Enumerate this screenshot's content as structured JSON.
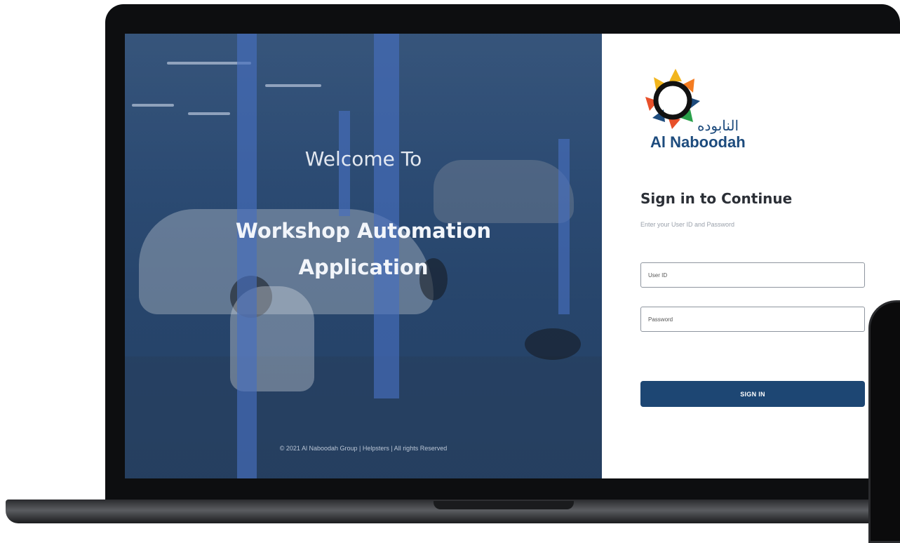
{
  "hero": {
    "welcome_line1": "Welcome To",
    "welcome_line2": "Workshop Automation",
    "welcome_line3": "Application",
    "copyright": "© 2021 Al Naboodah Group | Helpsters | All rights Reserved",
    "overlay_color": "#1e3e68"
  },
  "brand": {
    "name": "Al Naboodah",
    "arabic_name": "النابوده",
    "colors": [
      "#f2b51d",
      "#e8502a",
      "#2aa04a",
      "#1d4b7d",
      "#f47b20"
    ]
  },
  "signin": {
    "title": "Sign in to Continue",
    "subtitle": "Enter your User ID and Password",
    "user_id_placeholder": "User ID",
    "password_placeholder": "Password",
    "button_label": "SIGN IN",
    "button_color": "#1d4673"
  }
}
